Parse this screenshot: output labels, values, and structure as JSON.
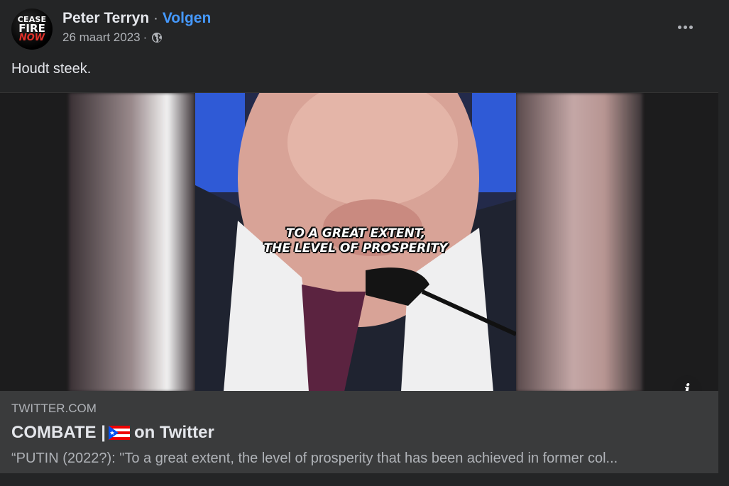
{
  "post": {
    "avatar_text": [
      "CEASE",
      "FIRE",
      "NOW"
    ],
    "author": "Peter Terryn",
    "separator": "·",
    "follow_label": "Volgen",
    "date": "26 maart 2023",
    "date_separator": "·",
    "privacy_icon": "globe-icon",
    "more_icon": "more-options-icon",
    "text": "Houdt steek."
  },
  "media": {
    "caption_line1": "TO A GREAT EXTENT,",
    "caption_line2": "THE LEVEL OF PROSPERITY",
    "info_icon": "info-icon",
    "info_label": "i"
  },
  "link": {
    "domain": "TWITTER.COM",
    "title_prefix": "COMBATE |",
    "title_flag": "puerto-rico-flag-icon",
    "title_suffix": "on Twitter",
    "description": "“PUTIN (2022?): \"To a great extent, the level of prosperity that has been achieved in former col..."
  },
  "colors": {
    "background": "#242526",
    "link_card": "#3a3b3c",
    "follow": "#4599ff",
    "secondary_text": "#b0b3b8"
  }
}
